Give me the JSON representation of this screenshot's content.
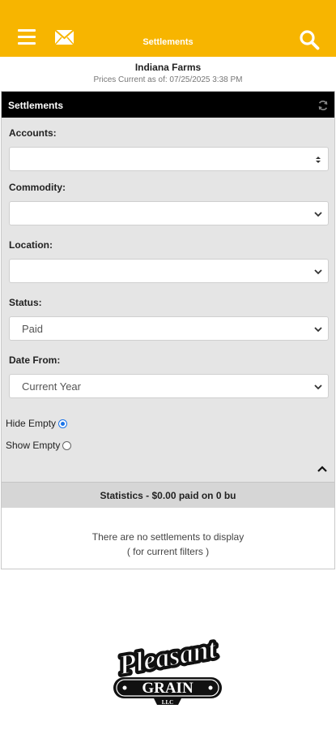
{
  "header": {
    "title": "Settlements",
    "accent_color": "#f7b500",
    "icons": [
      "menu-icon",
      "mail-icon",
      "search-icon"
    ]
  },
  "farm": {
    "name": "Indiana Farms",
    "prices_current": "Prices Current as of: 07/25/2025 3:38 PM"
  },
  "panel": {
    "title": "Settlements",
    "accounts": {
      "label": "Accounts:",
      "value": ""
    },
    "commodity": {
      "label": "Commodity:",
      "value": ""
    },
    "location": {
      "label": "Location:",
      "value": ""
    },
    "status": {
      "label": "Status:",
      "value": "Paid"
    },
    "date_from": {
      "label": "Date From:",
      "value": "Current Year"
    },
    "hide_empty": {
      "label": "Hide Empty",
      "checked": true
    },
    "show_empty": {
      "label": "Show Empty",
      "checked": false
    },
    "statistics": "Statistics - $0.00 paid on 0 bu",
    "empty_line1": "There are no settlements to display",
    "empty_line2": "( for current filters )"
  },
  "logo": {
    "text_top": "Pleasant",
    "text_bottom": "GRAIN",
    "text_small": "LLC"
  }
}
